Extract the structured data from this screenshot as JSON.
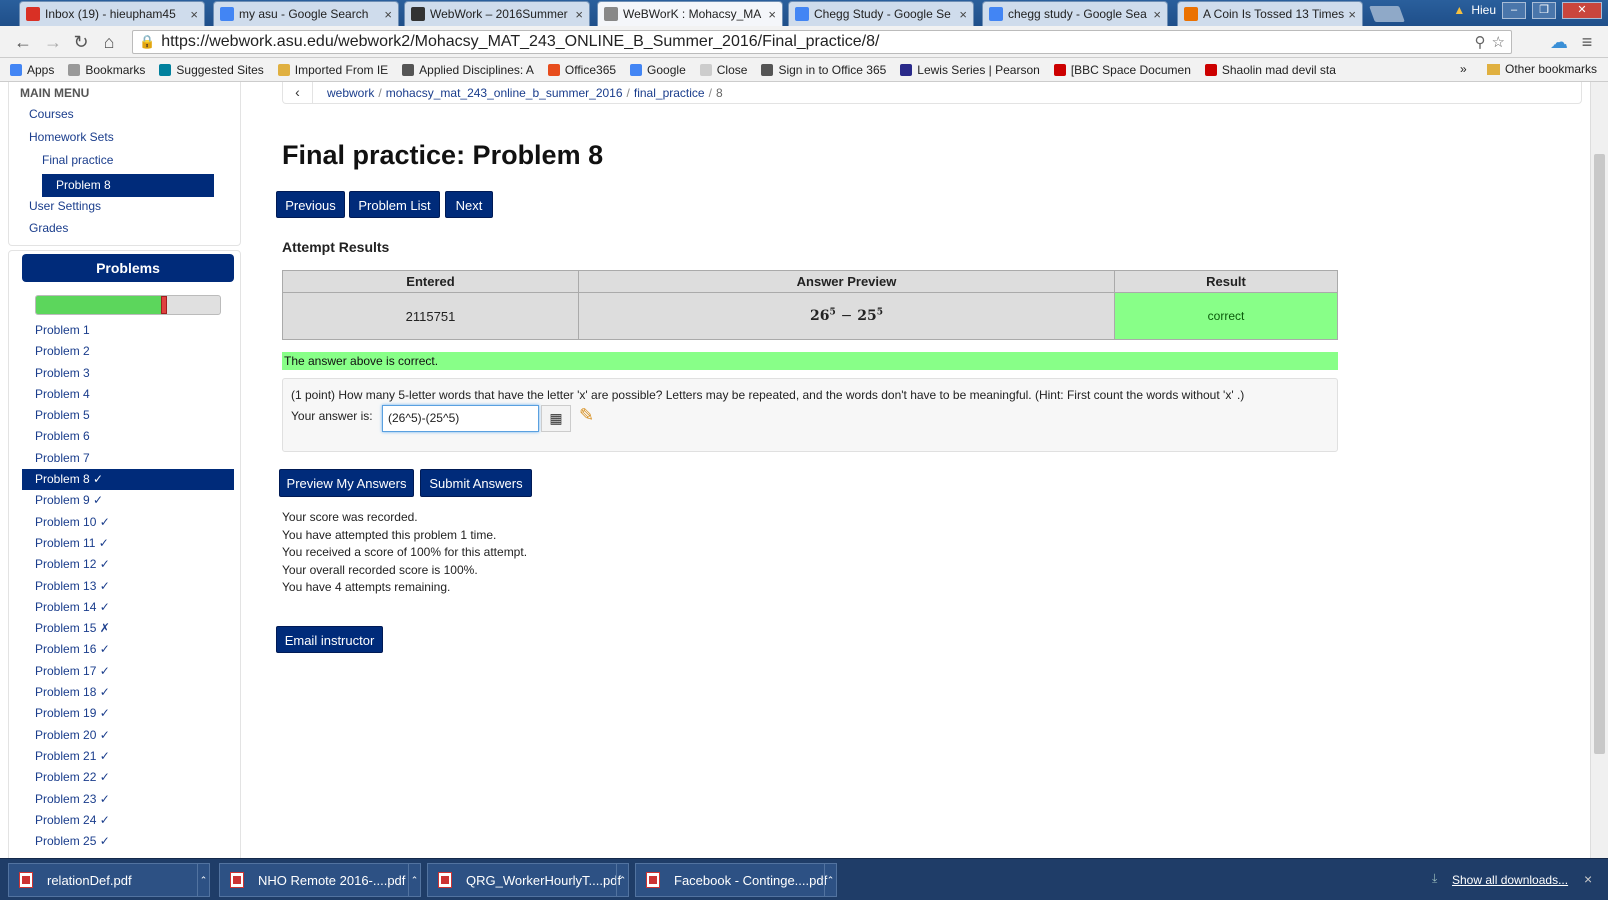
{
  "browser": {
    "tabs": [
      {
        "title": "Inbox (19) - hieupham45",
        "favicon": "gmail-icon",
        "color": "#d93025",
        "active": false
      },
      {
        "title": "my asu - Google Search",
        "favicon": "google-icon",
        "color": "#4285f4",
        "active": false
      },
      {
        "title": "WebWork – 2016Summer",
        "favicon": "blackboard-icon",
        "color": "#333333",
        "active": false
      },
      {
        "title": "WeBWorK : Mohacsy_MA",
        "favicon": "page-icon",
        "color": "#888888",
        "active": true
      },
      {
        "title": "Chegg Study - Google Se",
        "favicon": "google-icon",
        "color": "#4285f4",
        "active": false
      },
      {
        "title": "chegg study - Google Sea",
        "favicon": "google-icon",
        "color": "#4285f4",
        "active": false
      },
      {
        "title": "A Coin Is Tossed 13 Times",
        "favicon": "chegg-icon",
        "color": "#eb7100",
        "active": false
      }
    ],
    "user": "Hieu",
    "url": "https://webwork.asu.edu/webwork2/Mohacsy_MAT_243_ONLINE_B_Summer_2016/Final_practice/8/",
    "bookmarks": [
      {
        "label": "Apps",
        "color": "#4285f4"
      },
      {
        "label": "Bookmarks",
        "color": "#999999"
      },
      {
        "label": "Suggested Sites",
        "color": "#00809d"
      },
      {
        "label": "Imported From IE",
        "color": "#e0b040"
      },
      {
        "label": "Applied Disciplines: A",
        "color": "#555555"
      },
      {
        "label": "Office365",
        "color": "#e74c1c"
      },
      {
        "label": "Google",
        "color": "#4285f4"
      },
      {
        "label": "Close",
        "color": "#cccccc"
      },
      {
        "label": "Sign in to Office 365",
        "color": "#555555"
      },
      {
        "label": "Lewis Series | Pearson",
        "color": "#2a2a8a"
      },
      {
        "label": "[BBC Space Documen",
        "color": "#cc0000"
      },
      {
        "label": "Shaolin mad devil sta",
        "color": "#cc0000"
      }
    ],
    "more_label": "»",
    "other_bookmarks": "Other bookmarks"
  },
  "sidebar": {
    "main_menu_title": "MAIN MENU",
    "links": [
      "Courses",
      "Homework Sets",
      "Final practice",
      "Problem 8",
      "User Settings",
      "Grades"
    ],
    "problems_header": "Problems",
    "progress": {
      "correct_fraction": 0.68,
      "wrong_fraction": 0.03
    },
    "problems": [
      "Problem 1",
      "Problem 2",
      "Problem 3",
      "Problem 4",
      "Problem 5",
      "Problem 6",
      "Problem 7",
      "Problem 8 ✓",
      "Problem 9 ✓",
      "Problem 10 ✓",
      "Problem 11 ✓",
      "Problem 12 ✓",
      "Problem 13 ✓",
      "Problem 14 ✓",
      "Problem 15 ✗",
      "Problem 16 ✓",
      "Problem 17 ✓",
      "Problem 18 ✓",
      "Problem 19 ✓",
      "Problem 20 ✓",
      "Problem 21 ✓",
      "Problem 22 ✓",
      "Problem 23 ✓",
      "Problem 24 ✓",
      "Problem 25 ✓"
    ],
    "current_index": 7
  },
  "breadcrumb": {
    "back": "‹",
    "items": [
      "webwork",
      "mohacsy_mat_243_online_b_summer_2016",
      "final_practice"
    ],
    "current": "8"
  },
  "page": {
    "title": "Final practice: Problem 8",
    "nav_buttons": {
      "previous": "Previous",
      "list": "Problem List",
      "next": "Next"
    },
    "attempt_heading": "Attempt Results",
    "results_headers": {
      "entered": "Entered",
      "preview": "Answer Preview",
      "result": "Result"
    },
    "results_row": {
      "entered": "2115751",
      "preview_base1": "26",
      "preview_exp1": "5",
      "preview_minus": "−",
      "preview_base2": "25",
      "preview_exp2": "5",
      "result": "correct"
    },
    "correct_message": "The answer above is correct.",
    "question": "(1 point) How many 5-letter words that have the letter 'x' are possible? Letters may be repeated, and the words don't have to be meaningful. (Hint: First count the words without 'x' .)",
    "answer_label": "Your answer is:",
    "answer_value": "(26^5)-(25^5)",
    "preview_button": "Preview My Answers",
    "submit_button": "Submit Answers",
    "score_lines": [
      "Your score was recorded.",
      "You have attempted this problem 1 time.",
      "You received a score of 100% for this attempt.",
      "Your overall recorded score is 100%.",
      "You have 4 attempts remaining."
    ],
    "email_button": "Email instructor"
  },
  "downloads": {
    "items": [
      "relationDef.pdf",
      "NHO Remote 2016-....pdf",
      "QRG_WorkerHourlyT....pdf",
      "Facebook - Continge....pdf"
    ],
    "show_all": "Show all downloads...",
    "close": "×"
  },
  "colors": {
    "primary": "#002b7a",
    "correct": "#88ff88",
    "link": "#1a3d8c"
  }
}
